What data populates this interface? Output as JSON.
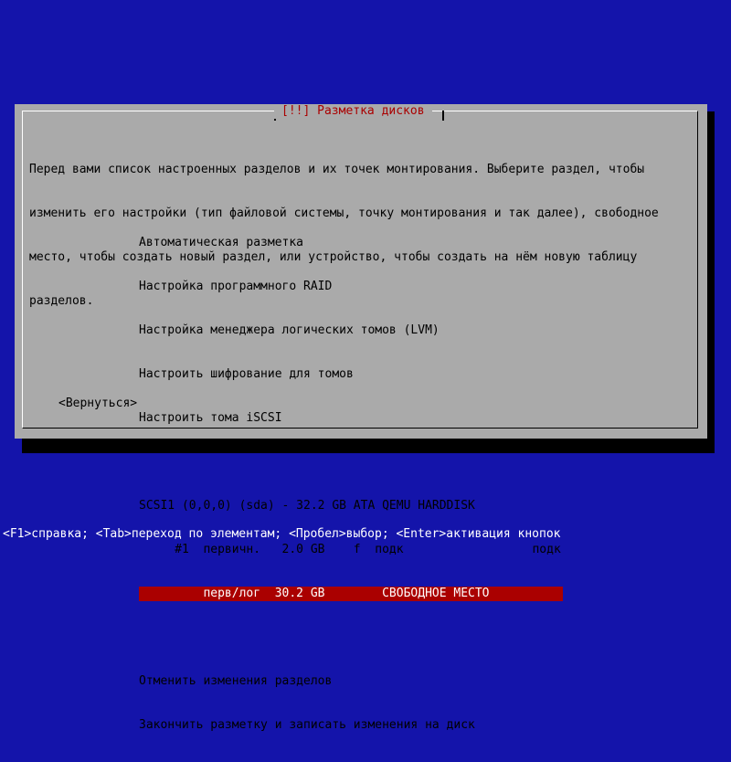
{
  "dialog": {
    "title": "[!!] Разметка дисков",
    "intro": [
      "Перед вами список настроенных разделов и их точек монтирования. Выберите раздел, чтобы",
      "изменить его настройки (тип файловой системы, точку монтирования и так далее), свободное",
      "место, чтобы создать новый раздел, или устройство, чтобы создать на нём новую таблицу",
      "разделов."
    ],
    "menu": {
      "auto": "Автоматическая разметка",
      "raid": "Настройка программного RAID",
      "lvm": "Настройка менеджера логических томов (LVM)",
      "crypt": "Настроить шифрование для томов",
      "iscsi": "Настроить тома iSCSI",
      "disk": "SCSI1 (0,0,0) (sda) - 32.2 GB ATA QEMU HARDDISK",
      "partition1": "     #1  первичн.   2.0 GB    f  подк                  подк",
      "free_space": "         перв/лог  30.2 GB        СВОБОДНОЕ МЕСТО",
      "undo": "Отменить изменения разделов",
      "finish": "Закончить разметку и записать изменения на диск"
    },
    "back_button": "<Вернуться>"
  },
  "status_bar": "<F1>справка; <Tab>переход по элементам; <Пробел>выбор; <Enter>активация кнопок",
  "colors": {
    "background": "#1414aa",
    "dialog": "#aaaaaa",
    "highlight": "#aa0000",
    "title_text": "#aa0000"
  }
}
